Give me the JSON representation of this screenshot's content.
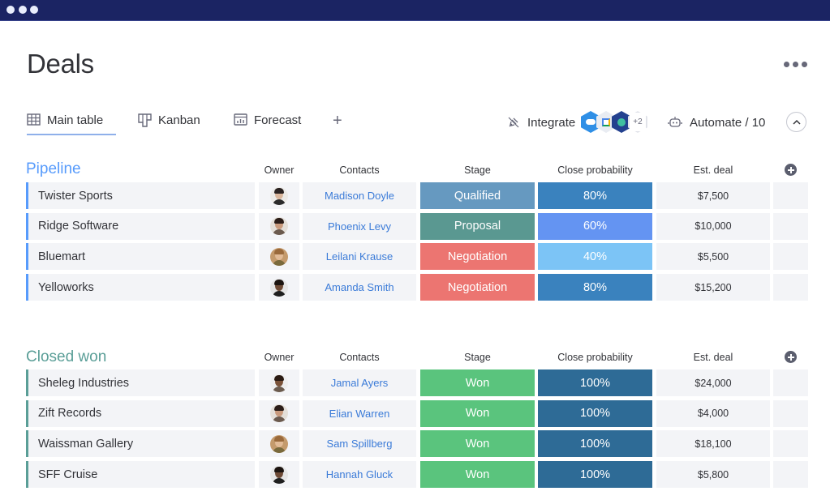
{
  "window": {
    "dots": 3
  },
  "page": {
    "title": "Deals"
  },
  "tabs": [
    {
      "label": "Main table",
      "icon": "table-icon",
      "active": true
    },
    {
      "label": "Kanban",
      "icon": "kanban-icon",
      "active": false
    },
    {
      "label": "Forecast",
      "icon": "forecast-chart-icon",
      "active": false
    }
  ],
  "toolbar": {
    "add_tab": "+",
    "integrate_label": "Integrate",
    "integrations": [
      {
        "name": "salesforce-icon",
        "color": "#2f8fe6"
      },
      {
        "name": "google-calendar-icon",
        "color": "#e9ecf2"
      },
      {
        "name": "integration-app-icon",
        "color": "#23418f"
      }
    ],
    "integrations_more": "+2",
    "automate_label": "Automate / 10"
  },
  "columns": {
    "owner": "Owner",
    "contacts": "Contacts",
    "stage": "Stage",
    "probability": "Close probability",
    "deal": "Est. deal"
  },
  "groups": [
    {
      "title": "Pipeline",
      "color": "#579bfc",
      "rows": [
        {
          "name": "Twister Sports",
          "owner": "man-short-hair",
          "contact": "Madison Doyle",
          "stage": "Qualified",
          "stage_color": "#6699c0",
          "probability": "80%",
          "prob_color": "#3a82be",
          "deal": "$7,500"
        },
        {
          "name": "Ridge Software",
          "owner": "woman-dark-hair",
          "contact": "Phoenix Levy",
          "stage": "Proposal",
          "stage_color": "#5a9891",
          "probability": "60%",
          "prob_color": "#6494f2",
          "deal": "$10,000"
        },
        {
          "name": "Bluemart",
          "owner": "woman-light-hair",
          "contact": "Leilani Krause",
          "stage": "Negotiation",
          "stage_color": "#ec7571",
          "probability": "40%",
          "prob_color": "#7cc4f6",
          "deal": "$5,500"
        },
        {
          "name": "Yelloworks",
          "owner": "man-beard",
          "contact": "Amanda Smith",
          "stage": "Negotiation",
          "stage_color": "#ec7571",
          "probability": "80%",
          "prob_color": "#3a82be",
          "deal": "$15,200"
        }
      ]
    },
    {
      "title": "Closed won",
      "color": "#5a9e97",
      "rows": [
        {
          "name": "Sheleg Industries",
          "owner": "man-dark-skin",
          "contact": "Jamal Ayers",
          "stage": "Won",
          "stage_color": "#5ac47d",
          "probability": "100%",
          "prob_color": "#2e6b96",
          "deal": "$24,000"
        },
        {
          "name": "Zift Records",
          "owner": "woman-dark-hair",
          "contact": "Elian Warren",
          "stage": "Won",
          "stage_color": "#5ac47d",
          "probability": "100%",
          "prob_color": "#2e6b96",
          "deal": "$4,000"
        },
        {
          "name": "Waissman Gallery",
          "owner": "woman-light-hair",
          "contact": "Sam Spillberg",
          "stage": "Won",
          "stage_color": "#5ac47d",
          "probability": "100%",
          "prob_color": "#2e6b96",
          "deal": "$18,100"
        },
        {
          "name": "SFF Cruise",
          "owner": "man-beard",
          "contact": "Hannah Gluck",
          "stage": "Won",
          "stage_color": "#5ac47d",
          "probability": "100%",
          "prob_color": "#2e6b96",
          "deal": "$5,800"
        }
      ]
    }
  ]
}
